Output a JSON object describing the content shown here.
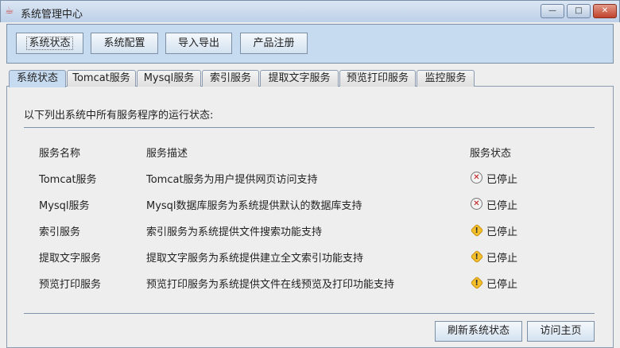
{
  "window": {
    "title": "系统管理中心",
    "minimize": "—",
    "maximize": "□",
    "close": "✕"
  },
  "toolbar": [
    "系统状态",
    "系统配置",
    "导入导出",
    "产品注册"
  ],
  "tabs": [
    "系统状态",
    "Tomcat服务",
    "Mysql服务",
    "索引服务",
    "提取文字服务",
    "预览打印服务",
    "监控服务"
  ],
  "main": {
    "intro": "以下列出系统中所有服务程序的运行状态:",
    "headers": [
      "服务名称",
      "服务描述",
      "服务状态"
    ],
    "rows": [
      {
        "name": "Tomcat服务",
        "desc": "Tomcat服务为用户提供网页访问支持",
        "status": "已停止",
        "icon": "error"
      },
      {
        "name": "Mysql服务",
        "desc": "Mysql数据库服务为系统提供默认的数据库支持",
        "status": "已停止",
        "icon": "error"
      },
      {
        "name": "索引服务",
        "desc": "索引服务为系统提供文件搜索功能支持",
        "status": "已停止",
        "icon": "warning"
      },
      {
        "name": "提取文字服务",
        "desc": "提取文字服务为系统提供建立全文索引功能支持",
        "status": "已停止",
        "icon": "warning"
      },
      {
        "name": "预览打印服务",
        "desc": "预览打印服务为系统提供文件在线预览及打印功能支持",
        "status": "已停止",
        "icon": "warning"
      }
    ],
    "buttons": [
      "刷新系统状态",
      "访问主页"
    ]
  }
}
